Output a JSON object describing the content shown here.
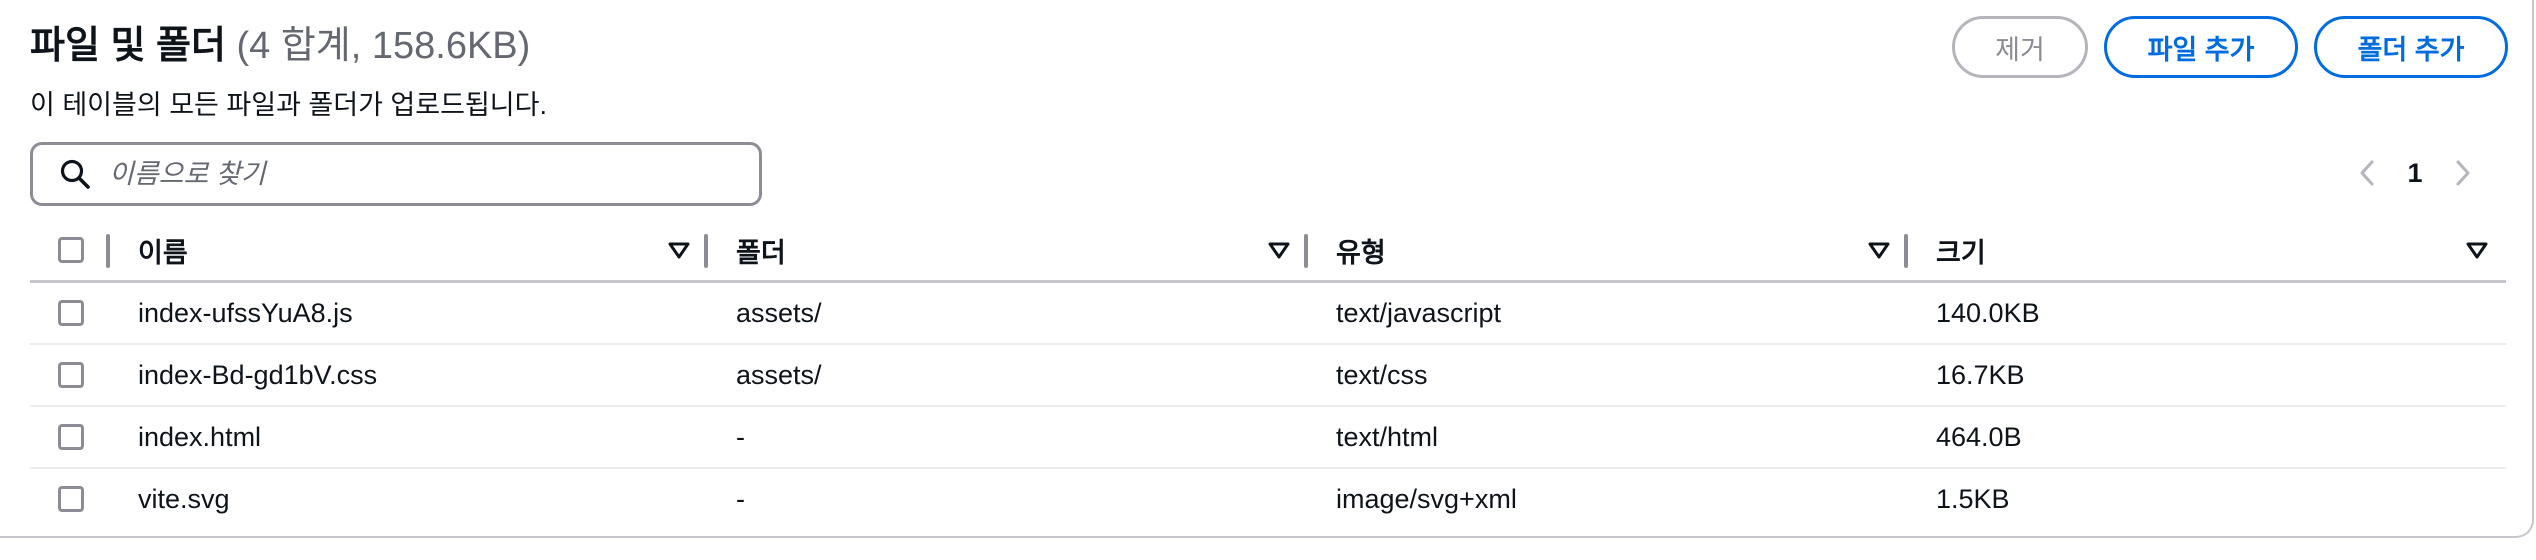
{
  "header": {
    "title": "파일 및 폴더",
    "count": "(4 합계, 158.6KB)",
    "description": "이 테이블의 모든 파일과 폴더가 업로드됩니다."
  },
  "actions": {
    "remove_label": "제거",
    "add_file_label": "파일 추가",
    "add_folder_label": "폴더 추가"
  },
  "search": {
    "placeholder": "이름으로 찾기",
    "icon": "search-icon"
  },
  "pagination": {
    "current_page": "1",
    "prev_icon": "chevron-left-icon",
    "next_icon": "chevron-right-icon"
  },
  "table": {
    "columns": [
      "이름",
      "폴더",
      "유형",
      "크기"
    ],
    "rows": [
      {
        "name": "index-ufssYuA8.js",
        "folder": "assets/",
        "type": "text/javascript",
        "size": "140.0KB"
      },
      {
        "name": "index-Bd-gd1bV.css",
        "folder": "assets/",
        "type": "text/css",
        "size": "16.7KB"
      },
      {
        "name": "index.html",
        "folder": "-",
        "type": "text/html",
        "size": "464.0B"
      },
      {
        "name": "vite.svg",
        "folder": "-",
        "type": "image/svg+xml",
        "size": "1.5KB"
      }
    ]
  },
  "colors": {
    "primary": "#006ce0",
    "text": "#0f141a",
    "muted": "#656871",
    "border": "#8c8c94",
    "disabled": "#b4b4bb"
  }
}
